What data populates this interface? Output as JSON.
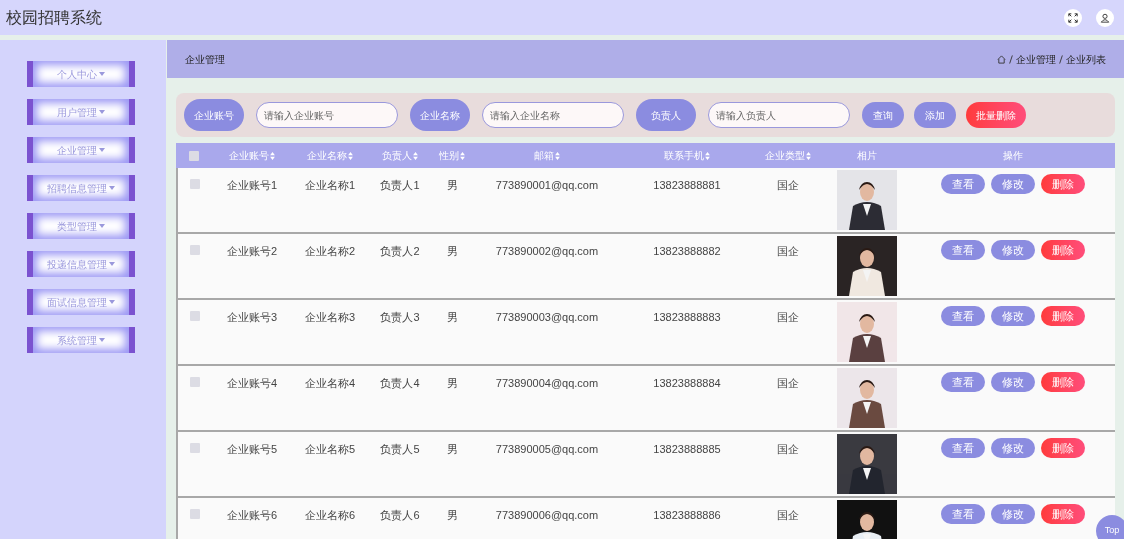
{
  "app_title": "校园招聘系统",
  "sidebar": {
    "items": [
      {
        "label": "个人中心"
      },
      {
        "label": "用户管理"
      },
      {
        "label": "企业管理"
      },
      {
        "label": "招聘信息管理"
      },
      {
        "label": "类型管理"
      },
      {
        "label": "投递信息管理"
      },
      {
        "label": "面试信息管理"
      },
      {
        "label": "系统管理"
      }
    ]
  },
  "page_title": "企业管理",
  "breadcrumb": [
    "企业管理",
    "企业列表"
  ],
  "search": {
    "fields": [
      {
        "label": "企业账号",
        "placeholder": "请输入企业账号"
      },
      {
        "label": "企业名称",
        "placeholder": "请输入企业名称"
      },
      {
        "label": "负责人",
        "placeholder": "请输入负责人"
      }
    ],
    "buttons": [
      {
        "label": "查询",
        "kind": "normal"
      },
      {
        "label": "添加",
        "kind": "normal"
      },
      {
        "label": "批量删除",
        "kind": "danger"
      }
    ]
  },
  "table": {
    "header_checked": false,
    "columns": [
      {
        "label": "企业账号",
        "sortable": true
      },
      {
        "label": "企业名称",
        "sortable": true
      },
      {
        "label": "负责人",
        "sortable": true
      },
      {
        "label": "性别",
        "sortable": true
      },
      {
        "label": "邮箱",
        "sortable": true
      },
      {
        "label": "联系手机",
        "sortable": true
      },
      {
        "label": "企业类型",
        "sortable": true
      },
      {
        "label": "相片",
        "sortable": false
      },
      {
        "label": "操作",
        "sortable": false
      }
    ],
    "rows": [
      {
        "checked": false,
        "cells": [
          "企业账号1",
          "企业名称1",
          "负责人1",
          "男",
          "773890001@qq.com",
          "13823888881",
          "国企"
        ],
        "actions": [
          {
            "label": "查看",
            "kind": "normal"
          },
          {
            "label": "修改",
            "kind": "normal"
          },
          {
            "label": "删除",
            "kind": "danger"
          }
        ]
      },
      {
        "checked": false,
        "cells": [
          "企业账号2",
          "企业名称2",
          "负责人2",
          "男",
          "773890002@qq.com",
          "13823888882",
          "国企"
        ],
        "actions": [
          {
            "label": "查看",
            "kind": "normal"
          },
          {
            "label": "修改",
            "kind": "normal"
          },
          {
            "label": "删除",
            "kind": "danger"
          }
        ]
      },
      {
        "checked": false,
        "cells": [
          "企业账号3",
          "企业名称3",
          "负责人3",
          "男",
          "773890003@qq.com",
          "13823888883",
          "国企"
        ],
        "actions": [
          {
            "label": "查看",
            "kind": "normal"
          },
          {
            "label": "修改",
            "kind": "normal"
          },
          {
            "label": "删除",
            "kind": "danger"
          }
        ]
      },
      {
        "checked": false,
        "cells": [
          "企业账号4",
          "企业名称4",
          "负责人4",
          "男",
          "773890004@qq.com",
          "13823888884",
          "国企"
        ],
        "actions": [
          {
            "label": "查看",
            "kind": "normal"
          },
          {
            "label": "修改",
            "kind": "normal"
          },
          {
            "label": "删除",
            "kind": "danger"
          }
        ]
      },
      {
        "checked": false,
        "cells": [
          "企业账号5",
          "企业名称5",
          "负责人5",
          "男",
          "773890005@qq.com",
          "13823888885",
          "国企"
        ],
        "actions": [
          {
            "label": "查看",
            "kind": "normal"
          },
          {
            "label": "修改",
            "kind": "normal"
          },
          {
            "label": "删除",
            "kind": "danger"
          }
        ]
      },
      {
        "checked": false,
        "cells": [
          "企业账号6",
          "企业名称6",
          "负责人6",
          "男",
          "773890006@qq.com",
          "13823888886",
          "国企"
        ],
        "actions": [
          {
            "label": "查看",
            "kind": "normal"
          },
          {
            "label": "修改",
            "kind": "normal"
          },
          {
            "label": "删除",
            "kind": "danger"
          }
        ]
      }
    ]
  },
  "top_button": "Top"
}
